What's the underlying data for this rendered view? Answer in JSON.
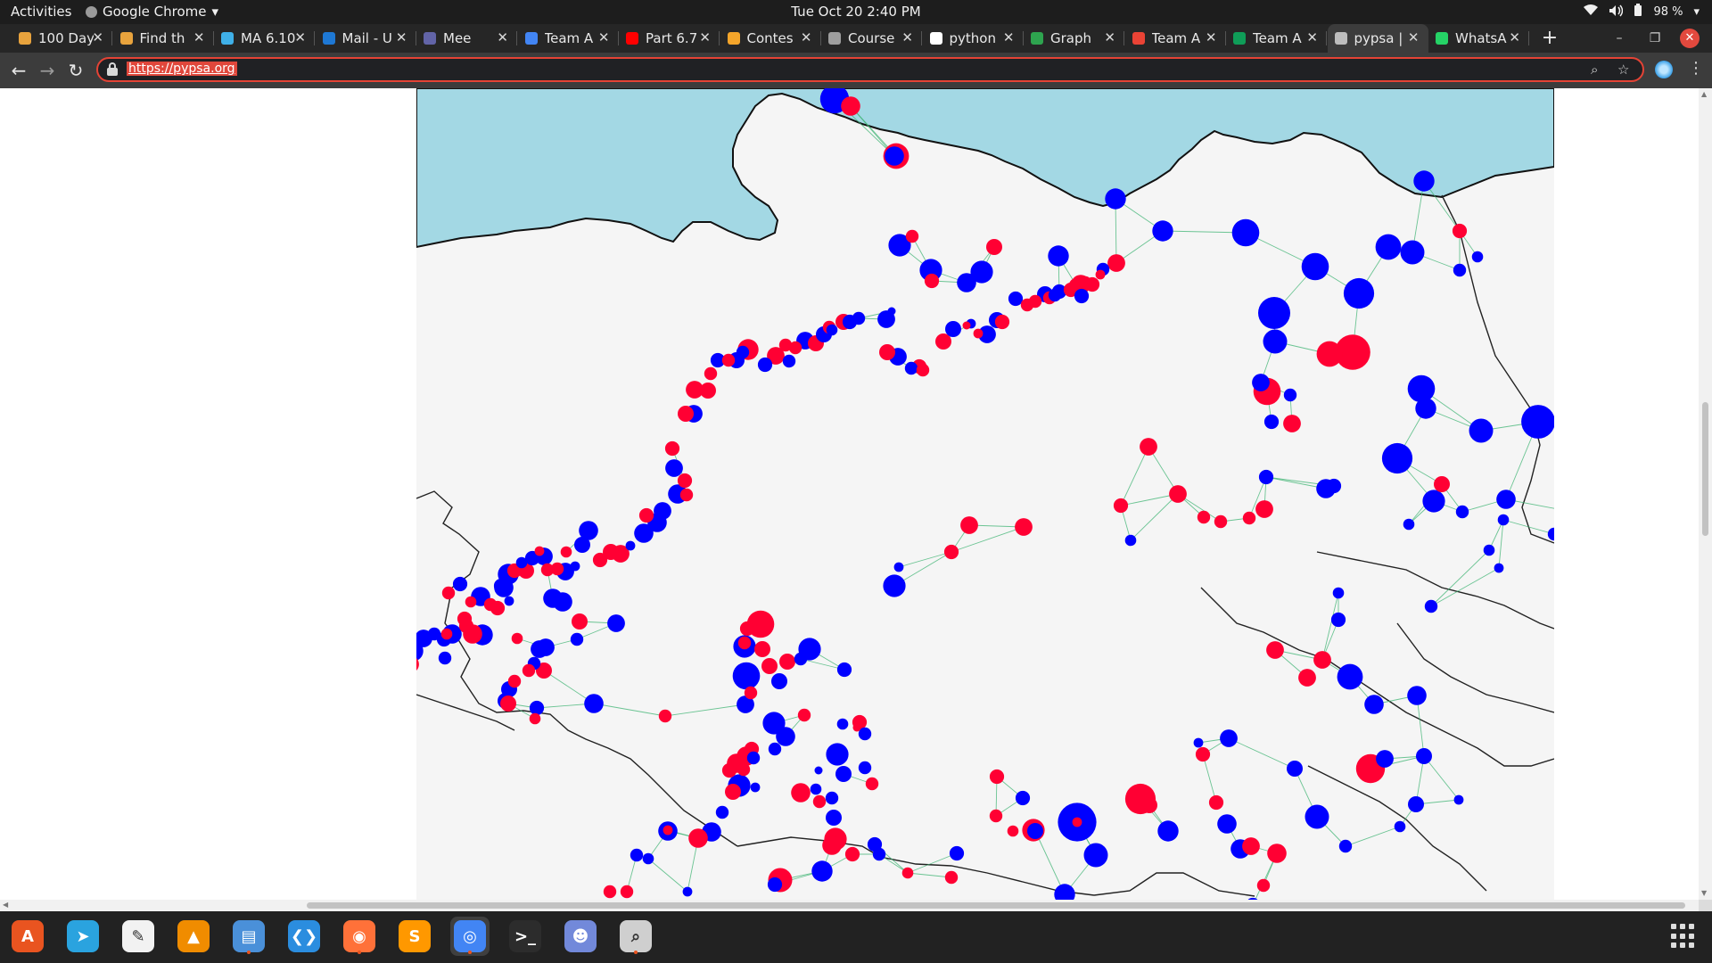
{
  "topbar": {
    "activities": "Activities",
    "app_name": "Google Chrome",
    "clock": "Tue Oct 20  2:40 PM",
    "battery": "98 %"
  },
  "tabs": [
    {
      "title": "100 Day",
      "icon": "calendar-grid-icon",
      "color": "#e8a33d"
    },
    {
      "title": "Find th",
      "icon": "calendar-grid-icon",
      "color": "#e8a33d"
    },
    {
      "title": "MA 6.10",
      "icon": "bar-chart-icon",
      "color": "#3fb0e8"
    },
    {
      "title": "Mail - U",
      "icon": "outlook-icon",
      "color": "#1e78d4"
    },
    {
      "title": "Mee",
      "icon": "teams-icon",
      "color": "#6264a7"
    },
    {
      "title": "Team A",
      "icon": "docs-icon",
      "color": "#4285f4"
    },
    {
      "title": "Part 6.7",
      "icon": "youtube-icon",
      "color": "#ff0000"
    },
    {
      "title": "Contes",
      "icon": "chart-icon",
      "color": "#f4a52a"
    },
    {
      "title": "Course",
      "icon": "course-icon",
      "color": "#9e9e9e"
    },
    {
      "title": "python",
      "icon": "google-icon",
      "color": "#ffffff"
    },
    {
      "title": "Graph",
      "icon": "graph-icon",
      "color": "#2ea44f"
    },
    {
      "title": "Team A",
      "icon": "gmail-icon",
      "color": "#ea4335"
    },
    {
      "title": "Team A",
      "icon": "sheets-icon",
      "color": "#0f9d58"
    },
    {
      "title": "pypsa |",
      "icon": "globe-icon",
      "color": "#bdbdbd"
    },
    {
      "title": "WhatsA",
      "icon": "whatsapp-icon",
      "color": "#25d366"
    }
  ],
  "active_tab_index": 13,
  "address_bar": {
    "url": "https://pypsa.org"
  },
  "map": {
    "sea_color": "#a3d8e4",
    "land_color": "#f5f5f5",
    "node_color_a": "#0000ff",
    "node_color_b": "#ff0033",
    "line_color": "#3cb371"
  },
  "dock": {
    "apps": [
      {
        "name": "ubuntu-software-icon",
        "color": "#e95420"
      },
      {
        "name": "telegram-icon",
        "color": "#2aa3df"
      },
      {
        "name": "text-editor-icon",
        "color": "#f2f2f2"
      },
      {
        "name": "vlc-icon",
        "color": "#f08c00"
      },
      {
        "name": "files-icon",
        "color": "#4a90d9"
      },
      {
        "name": "vscode-icon",
        "color": "#2b8ddf"
      },
      {
        "name": "firefox-icon",
        "color": "#ff7139"
      },
      {
        "name": "sublime-icon",
        "color": "#ff9800"
      },
      {
        "name": "chrome-icon",
        "color": "#4285f4"
      },
      {
        "name": "terminal-icon",
        "color": "#2c2c2c"
      },
      {
        "name": "discord-icon",
        "color": "#7289da"
      },
      {
        "name": "search-tool-icon",
        "color": "#cfcfcf"
      }
    ]
  }
}
